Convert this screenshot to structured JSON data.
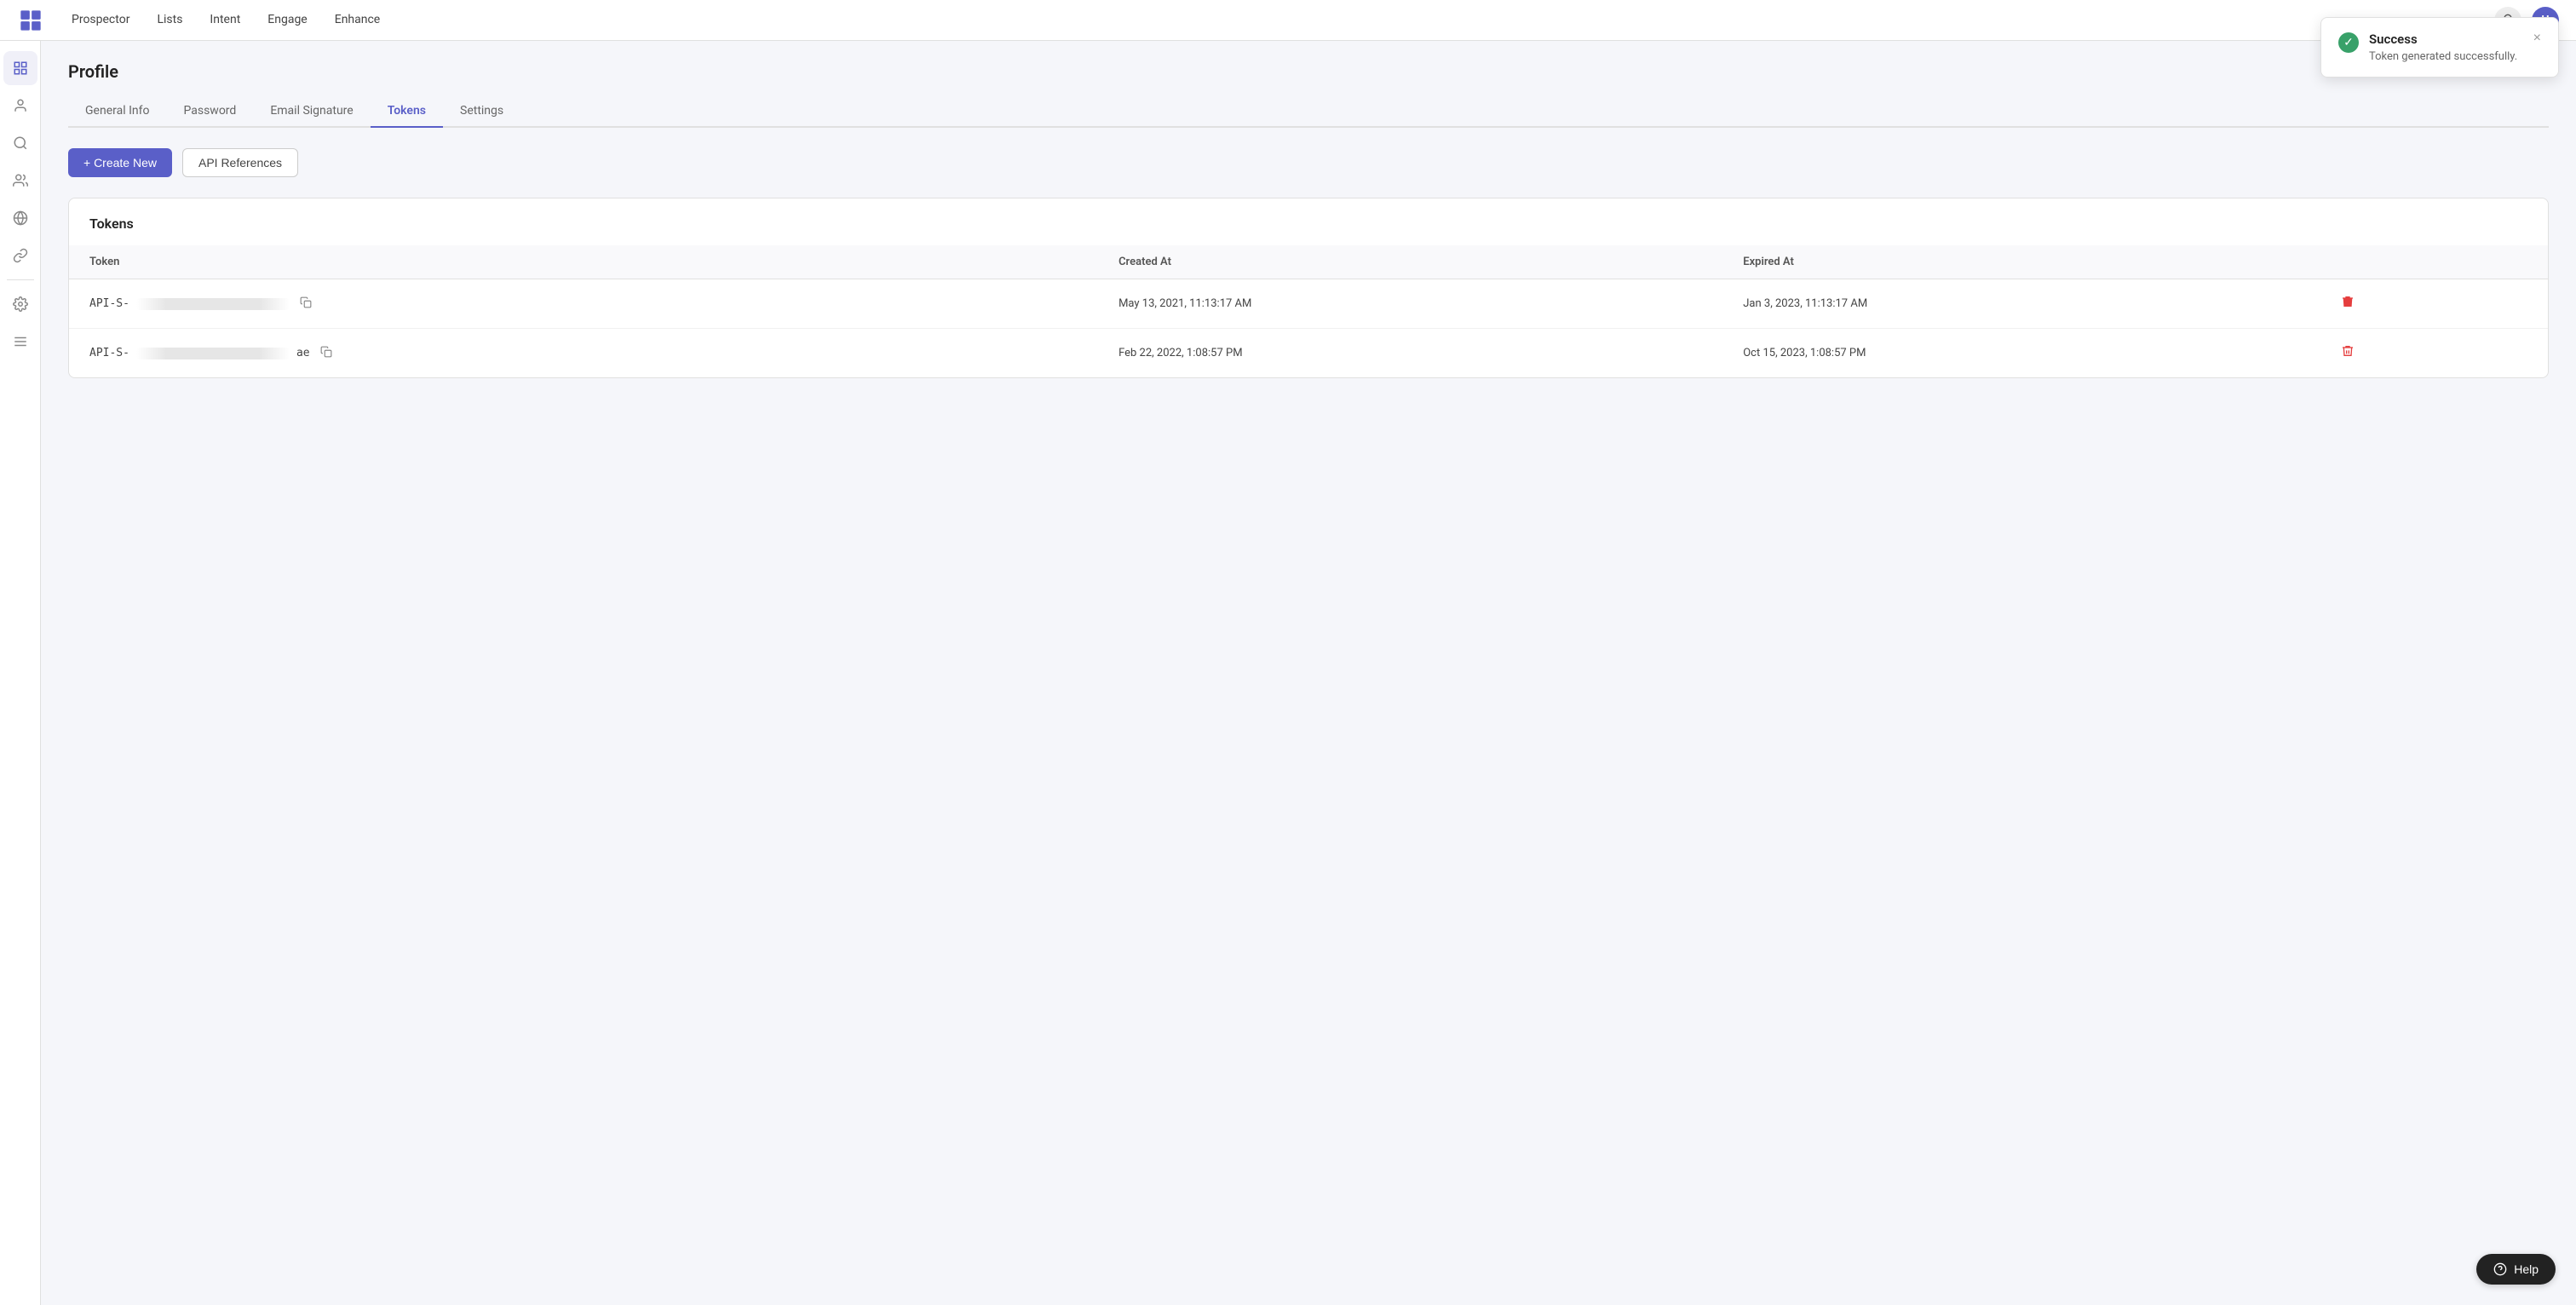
{
  "app": {
    "title": "Prospector"
  },
  "topnav": {
    "logo_title": "App",
    "items": [
      {
        "label": "Prospector",
        "active": true
      },
      {
        "label": "Lists",
        "active": false
      },
      {
        "label": "Intent",
        "active": false
      },
      {
        "label": "Engage",
        "active": false
      },
      {
        "label": "Enhance",
        "active": false
      }
    ]
  },
  "sidebar": {
    "icons": [
      {
        "name": "home-icon",
        "symbol": "⊞"
      },
      {
        "name": "user-icon",
        "symbol": "👤"
      },
      {
        "name": "search-icon",
        "symbol": "🔍"
      },
      {
        "name": "people-icon",
        "symbol": "👥"
      },
      {
        "name": "globe-icon",
        "symbol": "🌐"
      },
      {
        "name": "link-icon",
        "symbol": "🔗"
      },
      {
        "name": "settings-icon",
        "symbol": "⚙"
      },
      {
        "name": "layers-icon",
        "symbol": "≡"
      }
    ]
  },
  "profile": {
    "page_title": "Profile",
    "tabs": [
      {
        "label": "General Info",
        "active": false
      },
      {
        "label": "Password",
        "active": false
      },
      {
        "label": "Email Signature",
        "active": false
      },
      {
        "label": "Tokens",
        "active": true
      },
      {
        "label": "Settings",
        "active": false
      }
    ]
  },
  "actions": {
    "create_new_label": "+ Create New",
    "api_references_label": "API References"
  },
  "tokens_section": {
    "title": "Tokens",
    "columns": {
      "token": "Token",
      "created_at": "Created At",
      "expired_at": "Expired At"
    },
    "rows": [
      {
        "token_prefix": "API-S-",
        "token_blurred": true,
        "token_suffix": "",
        "created_at": "May 13, 2021, 11:13:17 AM",
        "expired_at": "Jan 3, 2023, 11:13:17 AM"
      },
      {
        "token_prefix": "API-S-",
        "token_blurred": true,
        "token_suffix": "ae",
        "created_at": "Feb 22, 2022, 1:08:57 PM",
        "expired_at": "Oct 15, 2023, 1:08:57 PM"
      }
    ]
  },
  "toast": {
    "title": "Success",
    "message": "Token generated successfully.",
    "close_label": "×"
  },
  "help": {
    "label": "Help"
  }
}
